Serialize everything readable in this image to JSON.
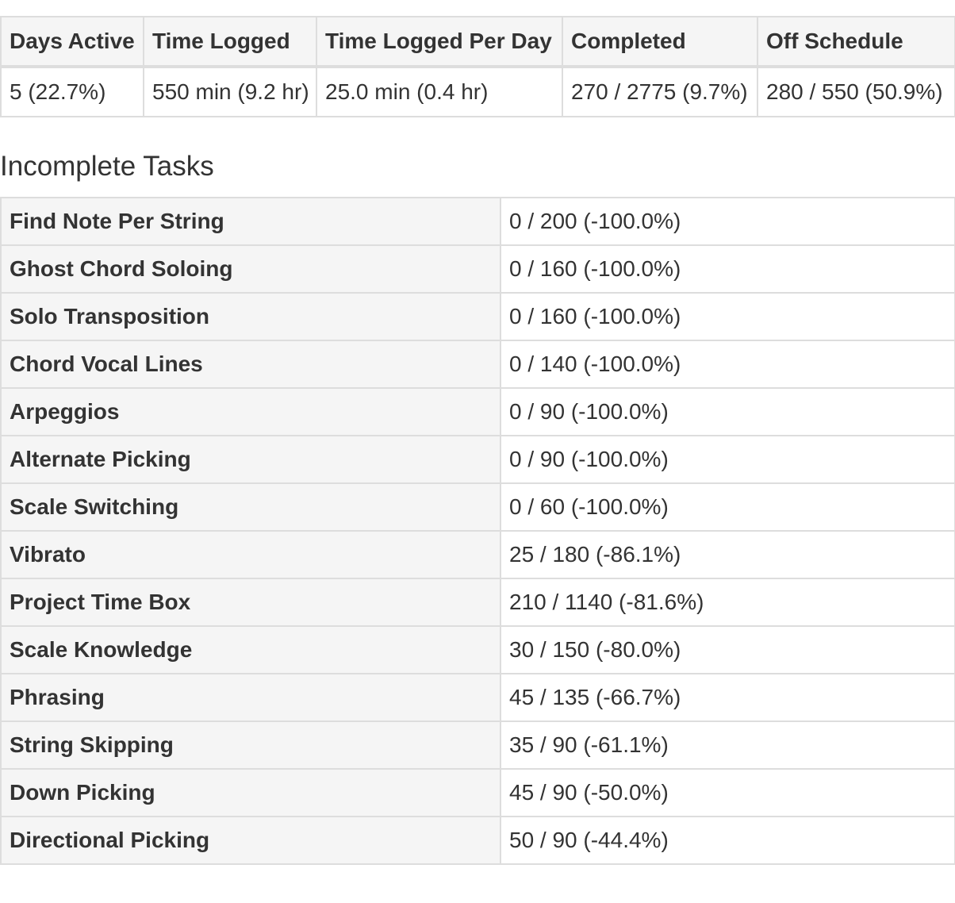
{
  "summary": {
    "headers": [
      "Days Active",
      "Time Logged",
      "Time Logged Per Day",
      "Completed",
      "Off Schedule"
    ],
    "values": [
      "5 (22.7%)",
      "550 min (9.2 hr)",
      "25.0 min (0.4 hr)",
      "270 / 2775 (9.7%)",
      "280 / 550 (50.9%)"
    ]
  },
  "incomplete_tasks": {
    "heading": "Incomplete Tasks",
    "rows": [
      {
        "name": "Find Note Per String",
        "value": "0 / 200 (-100.0%)"
      },
      {
        "name": "Ghost Chord Soloing",
        "value": "0 / 160 (-100.0%)"
      },
      {
        "name": "Solo Transposition",
        "value": "0 / 160 (-100.0%)"
      },
      {
        "name": "Chord Vocal Lines",
        "value": "0 / 140 (-100.0%)"
      },
      {
        "name": "Arpeggios",
        "value": "0 / 90 (-100.0%)"
      },
      {
        "name": "Alternate Picking",
        "value": "0 / 90 (-100.0%)"
      },
      {
        "name": "Scale Switching",
        "value": "0 / 60 (-100.0%)"
      },
      {
        "name": "Vibrato",
        "value": "25 / 180 (-86.1%)"
      },
      {
        "name": "Project Time Box",
        "value": "210 / 1140 (-81.6%)"
      },
      {
        "name": "Scale Knowledge",
        "value": "30 / 150 (-80.0%)"
      },
      {
        "name": "Phrasing",
        "value": "45 / 135 (-66.7%)"
      },
      {
        "name": "String Skipping",
        "value": "35 / 90 (-61.1%)"
      },
      {
        "name": "Down Picking",
        "value": "45 / 90 (-50.0%)"
      },
      {
        "name": "Directional Picking",
        "value": "50 / 90 (-44.4%)"
      }
    ]
  }
}
